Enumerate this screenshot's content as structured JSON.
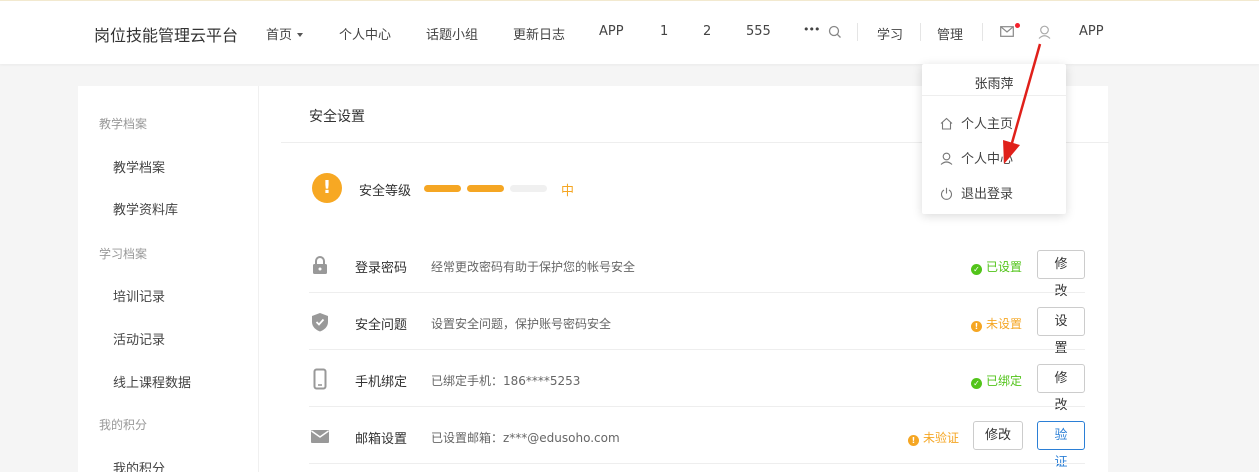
{
  "header": {
    "brand": "岗位技能管理云平台",
    "nav": [
      {
        "label": "首页"
      },
      {
        "label": "个人中心"
      },
      {
        "label": "话题小组"
      },
      {
        "label": "更新日志"
      },
      {
        "label": "APP"
      },
      {
        "label": "1"
      },
      {
        "label": "2"
      },
      {
        "label": "555"
      }
    ],
    "more_label": "•••",
    "study_label": "学习",
    "manage_label": "管理",
    "app_label": "APP",
    "icons": [
      "search-icon",
      "mail-icon",
      "user-icon"
    ]
  },
  "sidebar": {
    "groups": [
      {
        "title": "教学档案",
        "items": [
          "教学档案",
          "教学资料库"
        ]
      },
      {
        "title": "学习档案",
        "items": [
          "培训记录",
          "活动记录",
          "线上课程数据"
        ]
      },
      {
        "title": "我的积分",
        "items": [
          "我的积分"
        ]
      }
    ]
  },
  "main": {
    "title": "安全设置",
    "level": {
      "label": "安全等级",
      "text": "中",
      "filled": 2,
      "total": 3
    },
    "rows": [
      {
        "name": "登录密码",
        "desc": "经常更改密码有助于保护您的帐号安全",
        "status": "已设置",
        "state": "ok",
        "buttons": [
          "修改"
        ]
      },
      {
        "name": "安全问题",
        "desc": "设置安全问题，保护账号密码安全",
        "status": "未设置",
        "state": "warn",
        "buttons": [
          "设置"
        ]
      },
      {
        "name": "手机绑定",
        "desc": "已绑定手机：186****5253",
        "status": "已绑定",
        "state": "ok",
        "buttons": [
          "修改"
        ]
      },
      {
        "name": "邮箱设置",
        "desc": "已设置邮箱：z***@edusoho.com",
        "status": "未验证",
        "state": "warn",
        "buttons": [
          "修改",
          "验证"
        ]
      }
    ]
  },
  "dropdown": {
    "user": "张雨萍",
    "items": [
      "个人主页",
      "个人中心",
      "退出登录"
    ]
  },
  "colors": {
    "accent": "#f5a623",
    "ok": "#52c41a",
    "primary": "#2b7fd6",
    "arrow": "#e0201a"
  }
}
